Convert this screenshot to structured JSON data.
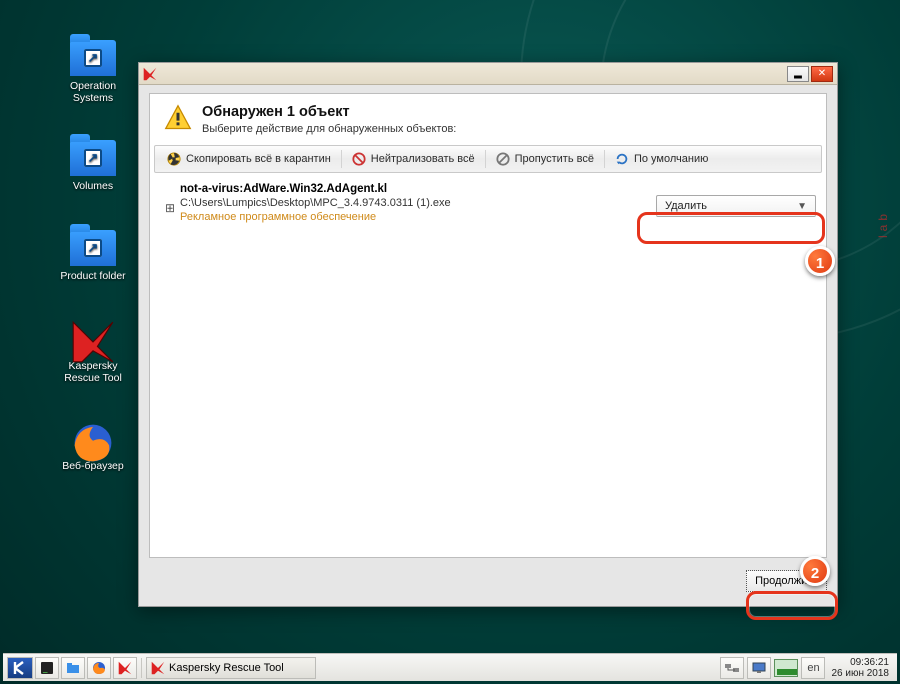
{
  "desktop_icons": {
    "operation_systems": "Operation\nSystems",
    "volumes": "Volumes",
    "product_folder": "Product folder",
    "kaspersky_rescue_tool": "Kaspersky\nRescue Tool",
    "web_browser": "Веб-браузер"
  },
  "window": {
    "title": "Обнаружен 1  объект",
    "subtitle": "Выберите действие для обнаруженных объектов:",
    "toolbar": {
      "quarantine_all": "Скопировать всё в карантин",
      "neutralize_all": "Нейтрализовать всё",
      "skip_all": "Пропустить всё",
      "default": "По умолчанию"
    },
    "item": {
      "name": "not-a-virus:AdWare.Win32.AdAgent.kl",
      "path": "C:\\Users\\Lumpics\\Desktop\\MPC_3.4.9743.0311 (1).exe",
      "category": "Рекламное программное обеспечение",
      "action_selected": "Удалить"
    },
    "continue_button": "Продолжить"
  },
  "wallpaper_side_text": "lab",
  "taskbar": {
    "task_label": "Kaspersky Rescue Tool",
    "lang": "en",
    "time": "09:36:21",
    "date": "26 июн 2018"
  },
  "annotations": {
    "step1": "1",
    "step2": "2"
  }
}
